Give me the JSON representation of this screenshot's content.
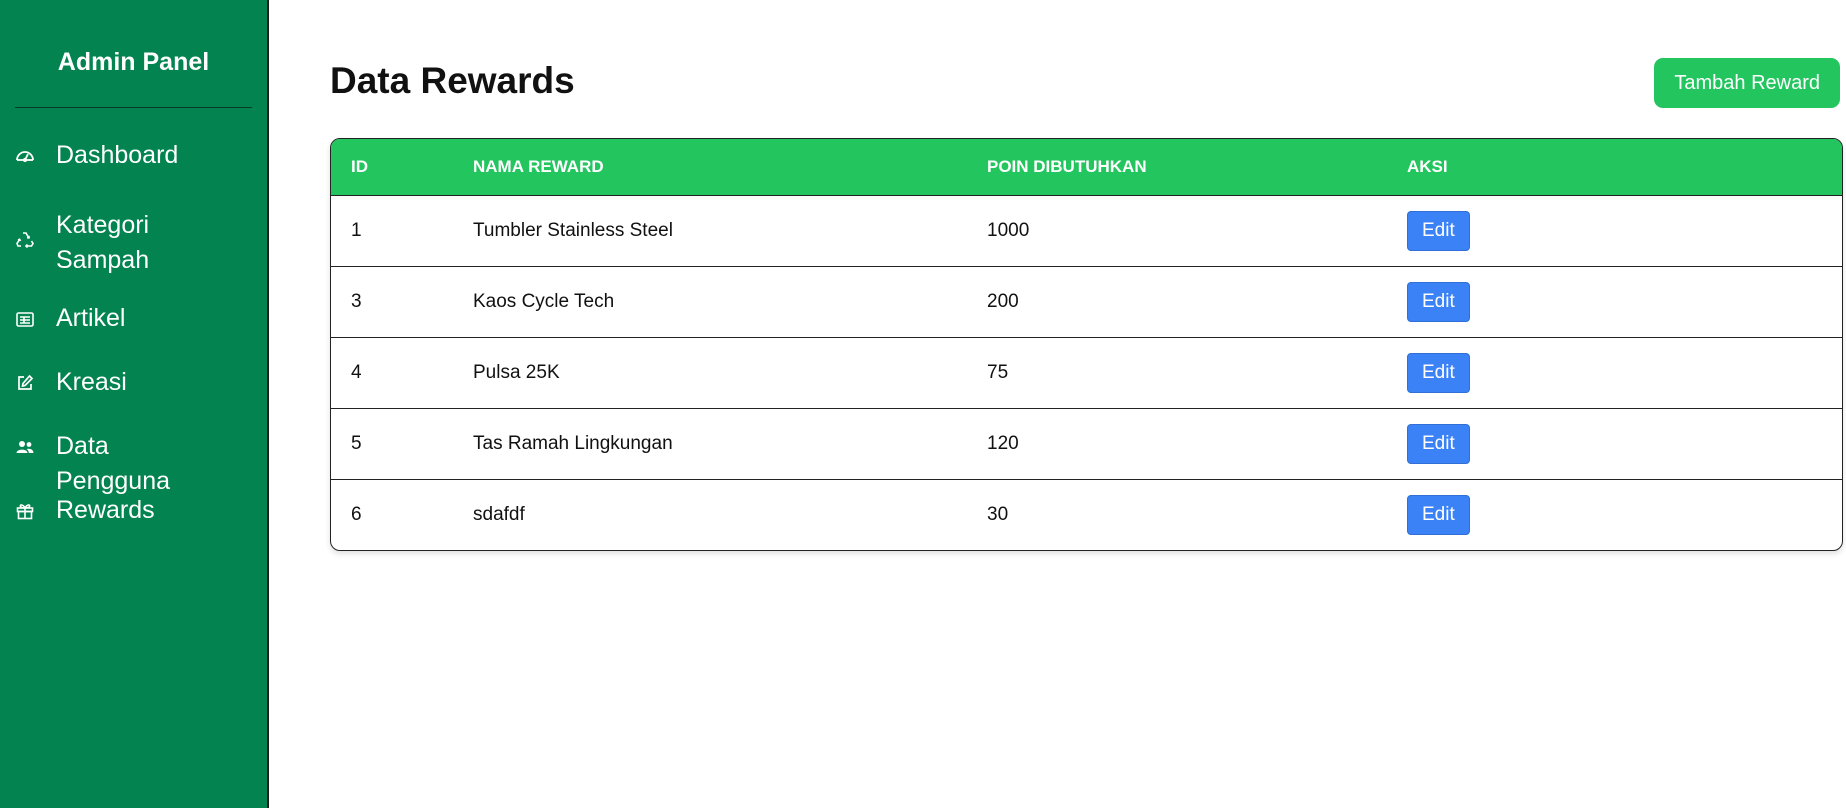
{
  "sidebar": {
    "brand": "Admin Panel",
    "items": [
      {
        "label": "Dashboard",
        "icon": "dashboard-gauge-icon"
      },
      {
        "label": "Kategori Sampah",
        "icon": "recycle-icon"
      },
      {
        "label": "Artikel",
        "icon": "newspaper-icon"
      },
      {
        "label": "Kreasi",
        "icon": "edit-icon"
      },
      {
        "label": "Data Pengguna",
        "icon": "users-icon"
      },
      {
        "label": "Rewards",
        "icon": "gift-icon"
      }
    ]
  },
  "main": {
    "title": "Data Rewards",
    "add_button_label": "Tambah Reward",
    "table": {
      "headers": [
        "ID",
        "NAMA REWARD",
        "POIN DIBUTUHKAN",
        "AKSI"
      ],
      "rows": [
        {
          "id": "1",
          "name": "Tumbler Stainless Steel",
          "poin": "1000",
          "action": "Edit"
        },
        {
          "id": "3",
          "name": "Kaos Cycle Tech",
          "poin": "200",
          "action": "Edit"
        },
        {
          "id": "4",
          "name": "Pulsa 25K",
          "poin": "75",
          "action": "Edit"
        },
        {
          "id": "5",
          "name": "Tas Ramah Lingkungan",
          "poin": "120",
          "action": "Edit"
        },
        {
          "id": "6",
          "name": "sdafdf",
          "poin": "30",
          "action": "Edit"
        }
      ]
    }
  },
  "colors": {
    "sidebar_bg": "#02834f",
    "accent_green": "#22c55e",
    "edit_blue": "#3b82f6"
  }
}
